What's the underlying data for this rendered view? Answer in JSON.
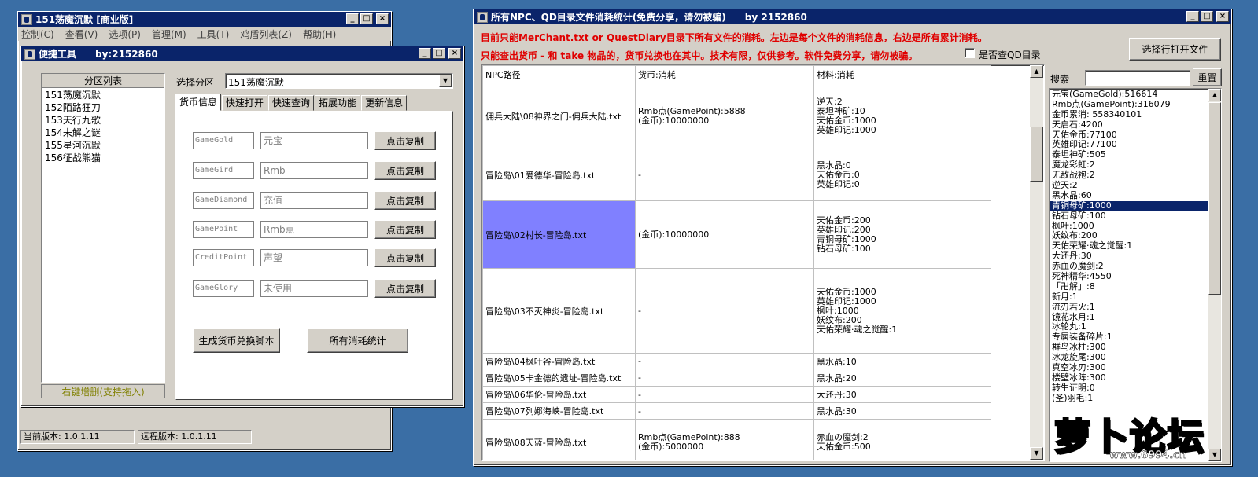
{
  "main_window": {
    "title": "151荡魔沉默 [商业版]",
    "menu": [
      "控制(C)",
      "查看(V)",
      "选项(P)",
      "管理(M)",
      "工具(T)",
      "鸡盾列表(Z)",
      "帮助(H)"
    ]
  },
  "tool_window": {
    "title": "便捷工具",
    "byline": "by:2152860",
    "partition_list_header": "分区列表",
    "partitions": [
      "151荡魔沉默",
      "152陌路狂刀",
      "153天行九歌",
      "154未解之谜",
      "155星河沉默",
      "156征战熊猫"
    ],
    "list_footer": "右键增删(支持拖入)",
    "select_partition_label": "选择分区",
    "selected_partition": "151荡魔沉默",
    "tabs": [
      "货币信息",
      "快速打开",
      "快速查询",
      "拓展功能",
      "更新信息"
    ],
    "currency_rows": [
      {
        "key": "GameGold",
        "name": "元宝",
        "button": "点击复制"
      },
      {
        "key": "GameGird",
        "name": "Rmb",
        "button": "点击复制"
      },
      {
        "key": "GameDiamond",
        "name": "充值",
        "button": "点击复制"
      },
      {
        "key": "GamePoint",
        "name": "Rmb点",
        "button": "点击复制"
      },
      {
        "key": "CreditPoint",
        "name": "声望",
        "button": "点击复制"
      },
      {
        "key": "GameGlory",
        "name": "未使用",
        "button": "点击复制"
      }
    ],
    "generate_button": "生成货币兑换脚本",
    "all_stats_button": "所有消耗统计",
    "current_version": "当前版本: 1.0.1.11",
    "remote_version": "远程版本: 1.0.1.11"
  },
  "stats_window": {
    "title": "所有NPC、QD目录文件消耗统计(免费分享，请勿被骗)",
    "byline": "by 2152860",
    "note1": "目前只能MerChant.txt or QuestDiary目录下所有文件的消耗。左边是每个文件的消耗信息，右边是所有累计消耗。",
    "note2": "只能查出货币 - 和 take 物品的，货币兑换也在其中。技术有限，仅供参考。软件免费分享，请勿被骗。",
    "checkbox_label": "是否查QD目录",
    "open_button": "选择行打开文件",
    "search_label": "搜索",
    "search_value": "",
    "reset_button": "重置",
    "columns": [
      "NPC路径",
      "货币:消耗",
      "材料:消耗"
    ],
    "rows": [
      {
        "path": "佣兵大陆\\08神界之门-佣兵大陆.txt",
        "currency": [
          "Rmb点(GamePoint):5888",
          "(金币):10000000"
        ],
        "materials": [
          "逆天:2",
          "泰坦神矿:10",
          "天佑金币:1000",
          "英雄印记:1000"
        ]
      },
      {
        "path": "冒险岛\\01爱德华-冒险岛.txt",
        "currency": [
          "-"
        ],
        "materials": [
          "黑水晶:0",
          "天佑金币:0",
          "英雄印记:0"
        ]
      },
      {
        "path": "冒险岛\\02村长-冒险岛.txt",
        "currency": [
          "(金币):10000000"
        ],
        "materials": [
          "天佑金币:200",
          "英雄印记:200",
          "青铜母矿:1000",
          "钻石母矿:100"
        ]
      },
      {
        "path": "冒险岛\\03不灭神炎-冒险岛.txt",
        "currency": [
          "-"
        ],
        "materials": [
          "天佑金币:1000",
          "英雄印记:1000",
          "枫叶:1000",
          "妖纹布:200",
          "天佑荣耀·魂之觉醒:1"
        ]
      },
      {
        "path": "冒险岛\\04枫叶谷-冒险岛.txt",
        "currency": [
          "-"
        ],
        "materials": [
          "黑水晶:10"
        ]
      },
      {
        "path": "冒险岛\\05卡金德的遗址-冒险岛.txt",
        "currency": [
          "-"
        ],
        "materials": [
          "黑水晶:20"
        ]
      },
      {
        "path": "冒险岛\\06华伦-冒险岛.txt",
        "currency": [
          "-"
        ],
        "materials": [
          "大还丹:30"
        ]
      },
      {
        "path": "冒险岛\\07列娜海峡-冒险岛.txt",
        "currency": [
          "-"
        ],
        "materials": [
          "黑水晶:30"
        ]
      },
      {
        "path": "冒险岛\\08天蓝-冒险岛.txt",
        "currency": [
          "Rmb点(GamePoint):888",
          "(金币):5000000"
        ],
        "materials": [
          "赤血の魔剑:2",
          "天佑金币:500"
        ]
      }
    ],
    "totals": [
      "元宝(GameGold):516614",
      "Rmb点(GamePoint):316079",
      "金币累消: 558340101",
      "天启石:4200",
      "天佑金币:77100",
      "英雄印记:77100",
      "泰坦神矿:505",
      "魔龙彩虹:2",
      "无敌战袍:2",
      "逆天:2",
      "黑水晶:60",
      "青铜母矿:1000",
      "钻石母矿:100",
      "枫叶:1000",
      "妖纹布:200",
      "天佑荣耀·魂之觉醒:1",
      "大还丹:30",
      "赤血の魔剑:2",
      "死神精华:4550",
      "「卍解」:8",
      "新月:1",
      "流刃若火:1",
      "镜花水月:1",
      "冰轮丸:1",
      "专属装备碎片:1",
      "群鸟冰柱:300",
      "冰龙旋尾:300",
      "真空冰刃:300",
      "楼壁冰阵:300",
      "转生证明:0",
      "(圣)羽毛:1"
    ],
    "selected_total_index": 11
  },
  "watermark": {
    "text": "萝卜论坛",
    "url": "www.6994.cn"
  }
}
